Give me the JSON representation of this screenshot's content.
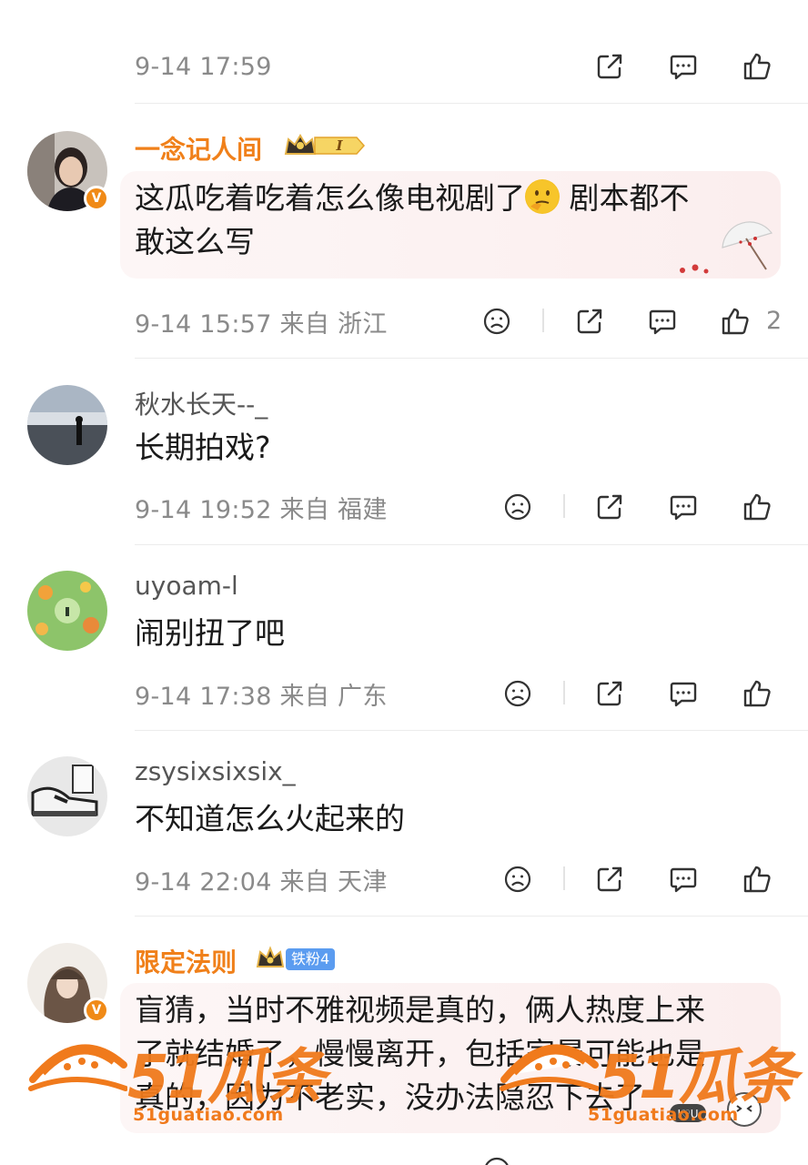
{
  "comments": [
    {
      "time": "9-14 17:59",
      "like_count": ""
    },
    {
      "username": "一念记人间",
      "crown_level": "I",
      "text_line1_a": "这瓜吃着吃着怎么像电视剧了",
      "emoji": "thinking-face",
      "text_line1_b": " 剧本都不",
      "text_line2": "敢这么写",
      "meta": "9-14 15:57 来自 浙江",
      "like_count": "2"
    },
    {
      "username": "秋水长天--_",
      "text": "长期拍戏?",
      "meta": "9-14 19:52 来自 福建"
    },
    {
      "username": "uyoam-l",
      "text": "闹别扭了吧",
      "meta": "9-14 17:38 来自 广东"
    },
    {
      "username": "zsysixsixsix_",
      "text": "不知道怎么火起来的",
      "meta": "9-14 22:04 来自 天津"
    },
    {
      "username": "限定法则",
      "fan_badge": "铁粉4",
      "text_line1": "盲猜，当时不雅视频是真的，俩人热度上来",
      "text_line2": "了就结婚了，慢慢离开，包括家暴可能也是",
      "text_line3": "真的，因为不老实，没办法隐忍下去了"
    }
  ],
  "watermark": {
    "logo": "51瓜条",
    "url": "51guatiao.com"
  },
  "icons": {
    "share": "share-icon",
    "comment": "comment-icon",
    "like": "thumbs-up-icon",
    "dislike": "sad-face-icon"
  },
  "colors": {
    "vip_name": "#f0801a",
    "meta": "#8a8a8a",
    "watermark": "#f07a1c"
  }
}
